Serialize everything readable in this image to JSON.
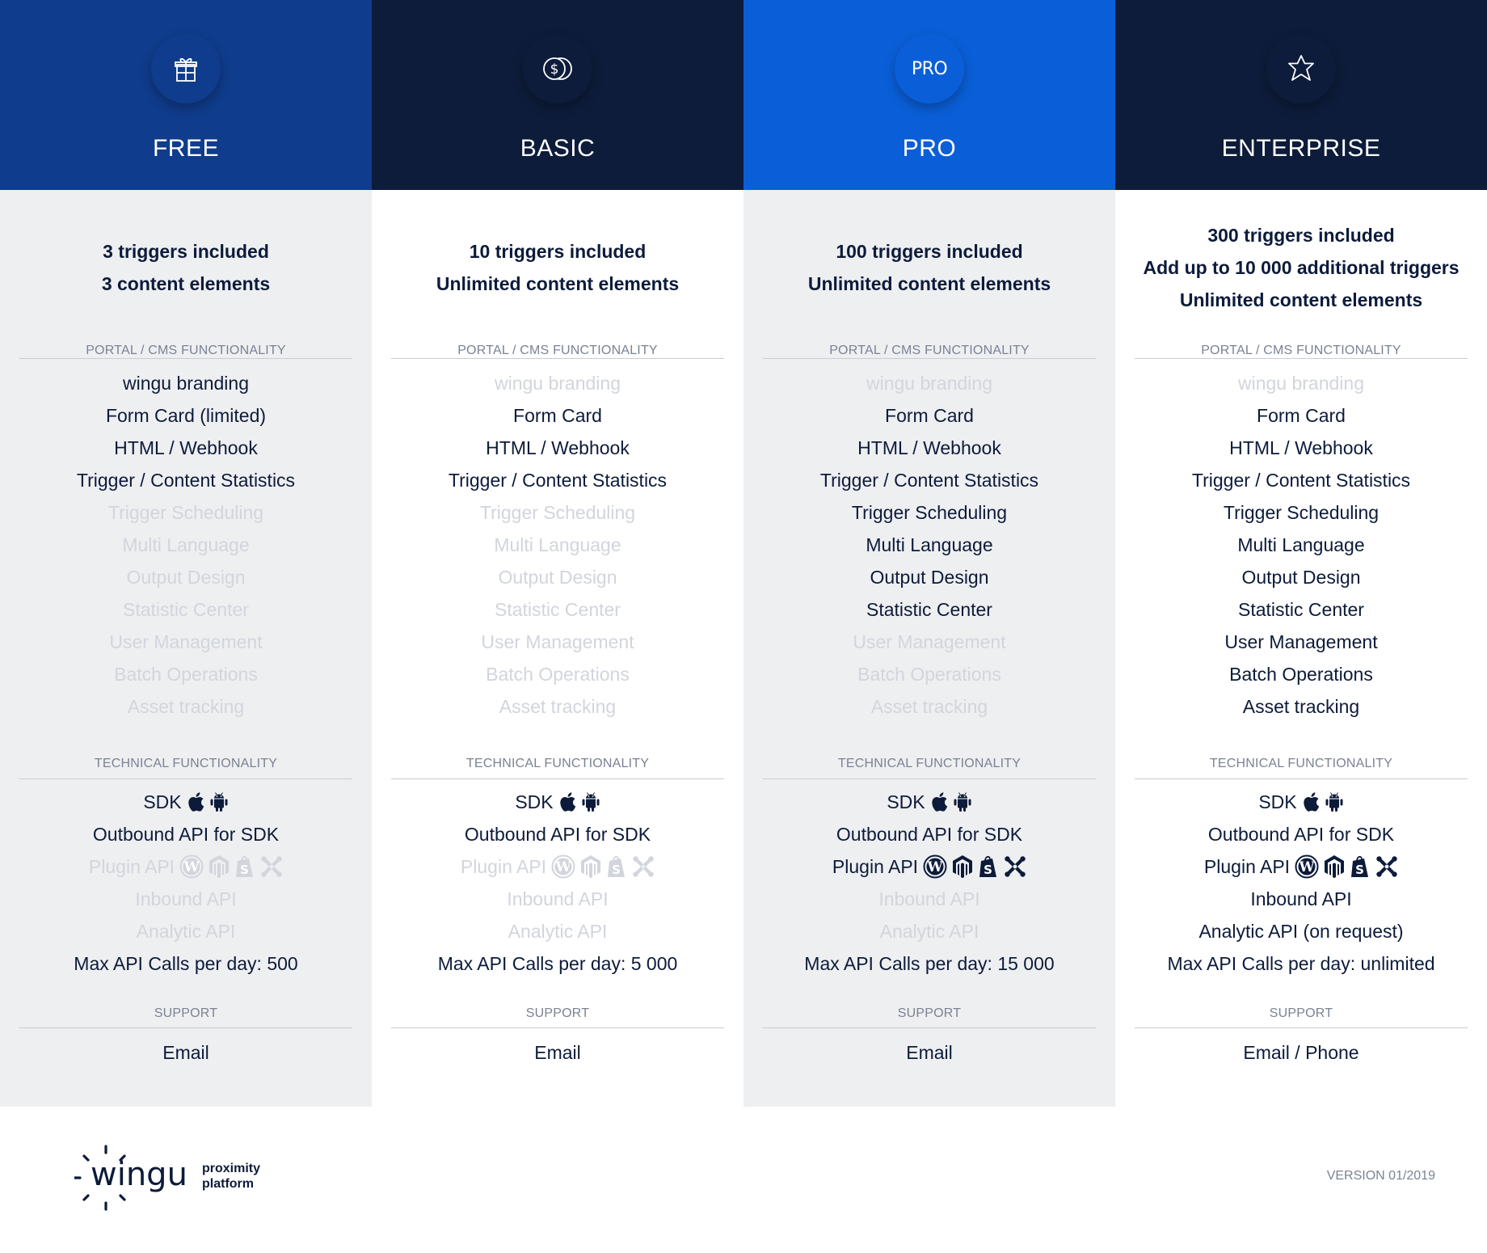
{
  "colors": {
    "free_header": "#0f3c8c",
    "basic_header": "#0d1c3a",
    "pro_header": "#0a5fd8",
    "enterprise_header": "#0d1c3a",
    "text_dark": "#0d1b3a",
    "text_disabled": "#d2d5dc",
    "section_title": "#7a8294"
  },
  "plans": [
    {
      "name": "FREE",
      "icon": "gift-icon",
      "included": [
        "3 triggers included",
        "3 content elements"
      ],
      "portal_title": "PORTAL / CMS FUNCTIONALITY",
      "portal": [
        {
          "label": "wingu branding",
          "enabled": true
        },
        {
          "label": "Form Card (limited)",
          "enabled": true
        },
        {
          "label": "HTML / Webhook",
          "enabled": true
        },
        {
          "label": "Trigger / Content Statistics",
          "enabled": true
        },
        {
          "label": "Trigger Scheduling",
          "enabled": false
        },
        {
          "label": "Multi Language",
          "enabled": false
        },
        {
          "label": "Output Design",
          "enabled": false
        },
        {
          "label": "Statistic Center",
          "enabled": false
        },
        {
          "label": "User Management",
          "enabled": false
        },
        {
          "label": "Batch Operations",
          "enabled": false
        },
        {
          "label": "Asset tracking",
          "enabled": false
        }
      ],
      "technical_title": "TECHNICAL FUNCTIONALITY",
      "technical": [
        {
          "label": "SDK",
          "enabled": true,
          "icons": [
            "apple-icon",
            "android-icon"
          ]
        },
        {
          "label": "Outbound API for SDK",
          "enabled": true
        },
        {
          "label": "Plugin API",
          "enabled": false,
          "icons": [
            "wordpress-icon",
            "magento-icon",
            "shopify-icon",
            "joomla-icon"
          ]
        },
        {
          "label": "Inbound API",
          "enabled": false
        },
        {
          "label": "Analytic API",
          "enabled": false
        },
        {
          "label": "Max API Calls per day: 500",
          "enabled": true
        }
      ],
      "support_title": "SUPPORT",
      "support": "Email"
    },
    {
      "name": "BASIC",
      "icon": "coins-icon",
      "included": [
        "10 triggers included",
        "Unlimited content elements"
      ],
      "portal_title": "PORTAL / CMS FUNCTIONALITY",
      "portal": [
        {
          "label": "wingu branding",
          "enabled": false
        },
        {
          "label": "Form Card",
          "enabled": true
        },
        {
          "label": "HTML / Webhook",
          "enabled": true
        },
        {
          "label": "Trigger / Content Statistics",
          "enabled": true
        },
        {
          "label": "Trigger Scheduling",
          "enabled": false
        },
        {
          "label": "Multi Language",
          "enabled": false
        },
        {
          "label": "Output Design",
          "enabled": false
        },
        {
          "label": "Statistic Center",
          "enabled": false
        },
        {
          "label": "User Management",
          "enabled": false
        },
        {
          "label": "Batch Operations",
          "enabled": false
        },
        {
          "label": "Asset tracking",
          "enabled": false
        }
      ],
      "technical_title": "TECHNICAL FUNCTIONALITY",
      "technical": [
        {
          "label": "SDK",
          "enabled": true,
          "icons": [
            "apple-icon",
            "android-icon"
          ]
        },
        {
          "label": "Outbound API for SDK",
          "enabled": true
        },
        {
          "label": "Plugin API",
          "enabled": false,
          "icons": [
            "wordpress-icon",
            "magento-icon",
            "shopify-icon",
            "joomla-icon"
          ]
        },
        {
          "label": "Inbound API",
          "enabled": false
        },
        {
          "label": "Analytic API",
          "enabled": false
        },
        {
          "label": "Max API Calls per day: 5 000",
          "enabled": true
        }
      ],
      "support_title": "SUPPORT",
      "support": "Email"
    },
    {
      "name": "PRO",
      "icon": "pro-badge-icon",
      "icon_text": "PRO",
      "included": [
        "100 triggers included",
        "Unlimited content elements"
      ],
      "portal_title": "PORTAL / CMS FUNCTIONALITY",
      "portal": [
        {
          "label": "wingu branding",
          "enabled": false
        },
        {
          "label": "Form Card",
          "enabled": true
        },
        {
          "label": "HTML / Webhook",
          "enabled": true
        },
        {
          "label": "Trigger / Content Statistics",
          "enabled": true
        },
        {
          "label": "Trigger Scheduling",
          "enabled": true
        },
        {
          "label": "Multi Language",
          "enabled": true
        },
        {
          "label": "Output Design",
          "enabled": true
        },
        {
          "label": "Statistic Center",
          "enabled": true
        },
        {
          "label": "User Management",
          "enabled": false
        },
        {
          "label": "Batch Operations",
          "enabled": false
        },
        {
          "label": "Asset tracking",
          "enabled": false
        }
      ],
      "technical_title": "TECHNICAL FUNCTIONALITY",
      "technical": [
        {
          "label": "SDK",
          "enabled": true,
          "icons": [
            "apple-icon",
            "android-icon"
          ]
        },
        {
          "label": "Outbound API for SDK",
          "enabled": true
        },
        {
          "label": "Plugin API",
          "enabled": true,
          "icons": [
            "wordpress-icon",
            "magento-icon",
            "shopify-icon",
            "joomla-icon"
          ]
        },
        {
          "label": "Inbound API",
          "enabled": false
        },
        {
          "label": "Analytic API",
          "enabled": false
        },
        {
          "label": "Max API Calls per day: 15 000",
          "enabled": true
        }
      ],
      "support_title": "SUPPORT",
      "support": "Email"
    },
    {
      "name": "ENTERPRISE",
      "icon": "star-icon",
      "included": [
        "300 triggers included",
        "Add up to 10 000 additional triggers",
        "Unlimited content elements"
      ],
      "portal_title": "PORTAL / CMS FUNCTIONALITY",
      "portal": [
        {
          "label": "wingu branding",
          "enabled": false
        },
        {
          "label": "Form Card",
          "enabled": true
        },
        {
          "label": "HTML / Webhook",
          "enabled": true
        },
        {
          "label": "Trigger / Content Statistics",
          "enabled": true
        },
        {
          "label": "Trigger Scheduling",
          "enabled": true
        },
        {
          "label": "Multi Language",
          "enabled": true
        },
        {
          "label": "Output Design",
          "enabled": true
        },
        {
          "label": "Statistic Center",
          "enabled": true
        },
        {
          "label": "User Management",
          "enabled": true
        },
        {
          "label": "Batch Operations",
          "enabled": true
        },
        {
          "label": "Asset tracking",
          "enabled": true
        }
      ],
      "technical_title": "TECHNICAL FUNCTIONALITY",
      "technical": [
        {
          "label": "SDK",
          "enabled": true,
          "icons": [
            "apple-icon",
            "android-icon"
          ]
        },
        {
          "label": "Outbound API for SDK",
          "enabled": true
        },
        {
          "label": "Plugin API",
          "enabled": true,
          "icons": [
            "wordpress-icon",
            "magento-icon",
            "shopify-icon",
            "joomla-icon"
          ]
        },
        {
          "label": "Inbound API",
          "enabled": true
        },
        {
          "label": "Analytic API (on request)",
          "enabled": true
        },
        {
          "label": "Max API Calls per day: unlimited",
          "enabled": true
        }
      ],
      "support_title": "SUPPORT",
      "support": "Email / Phone"
    }
  ],
  "footer": {
    "logo_word": "wingu",
    "logo_tagline_1": "proximity",
    "logo_tagline_2": "platform",
    "version": "VERSION 01/2019"
  }
}
